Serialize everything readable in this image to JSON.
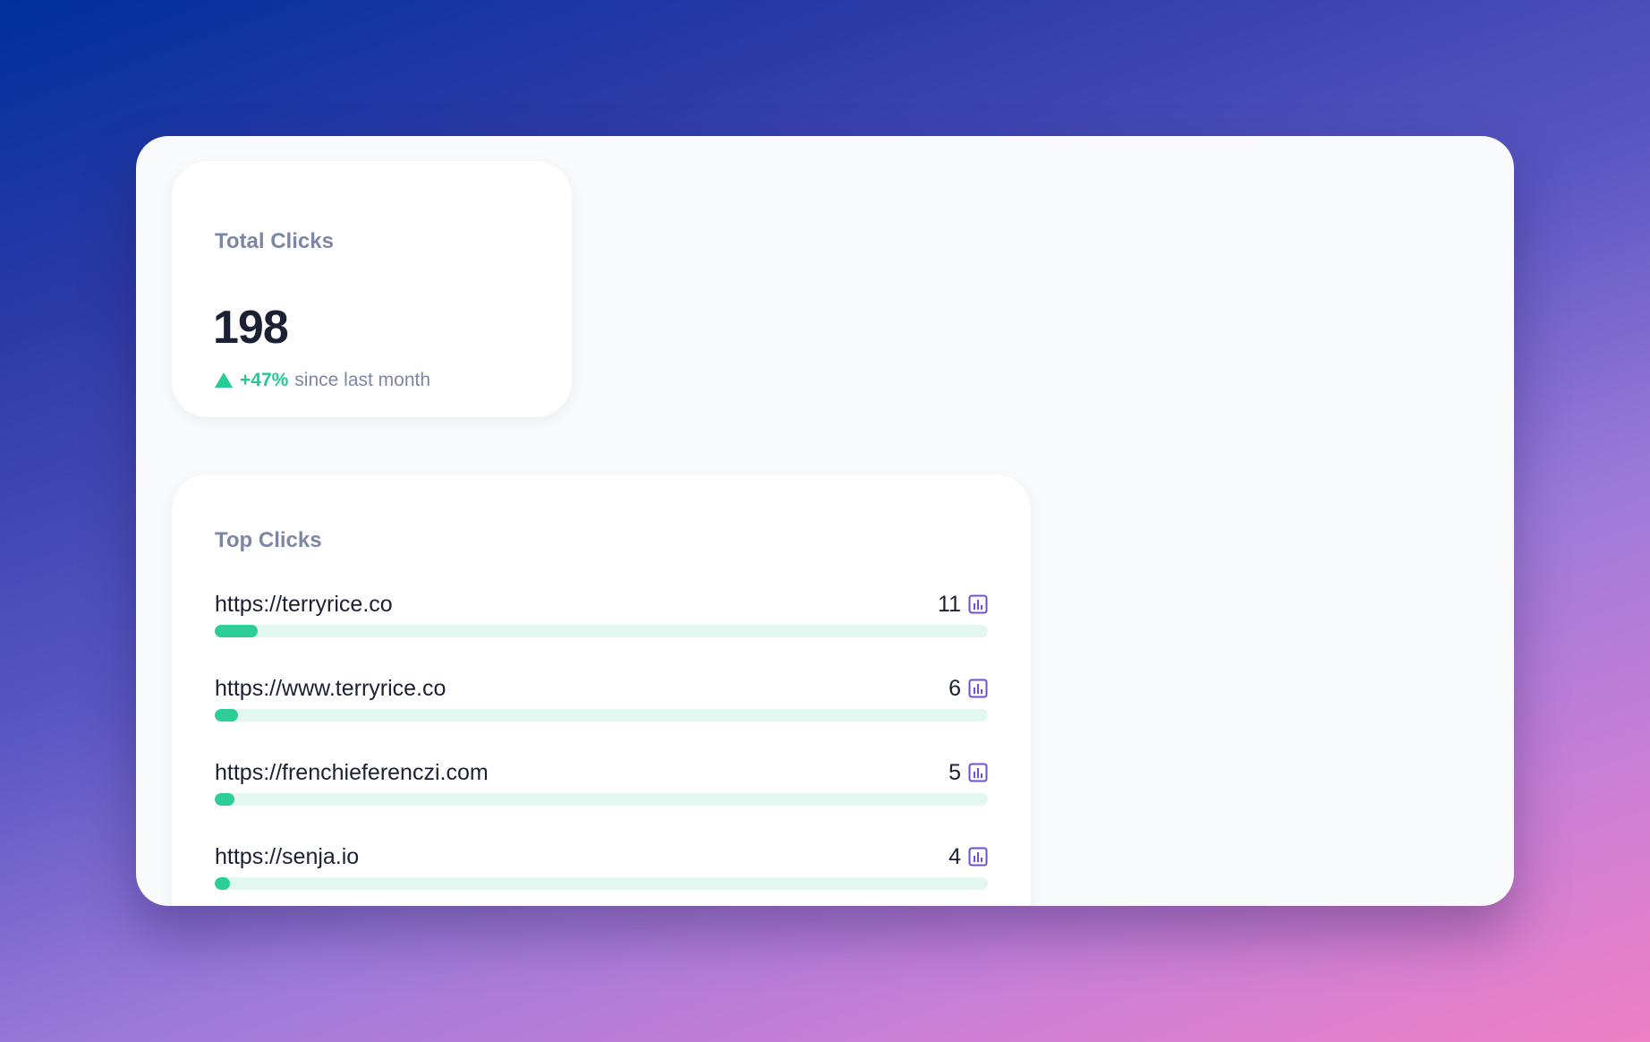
{
  "total_clicks": {
    "title": "Total Clicks",
    "value": "198",
    "trend_percent": "+47%",
    "trend_text": "since last month",
    "trend_direction": "up",
    "trend_color": "#26cc94"
  },
  "top_clicks": {
    "title": "Top Clicks",
    "rows": [
      {
        "url": "https://terryrice.co",
        "count": "11",
        "progress": 0.055
      },
      {
        "url": "https://www.terryrice.co",
        "count": "6",
        "progress": 0.03
      },
      {
        "url": "https://frenchieferenczi.com",
        "count": "5",
        "progress": 0.025
      },
      {
        "url": "https://senja.io",
        "count": "4",
        "progress": 0.02
      }
    ],
    "row_icon": "bar-chart-icon",
    "bar_color": "#2ccd97",
    "track_color": "#e2f7f0",
    "icon_color": "#6d4fd8"
  }
}
